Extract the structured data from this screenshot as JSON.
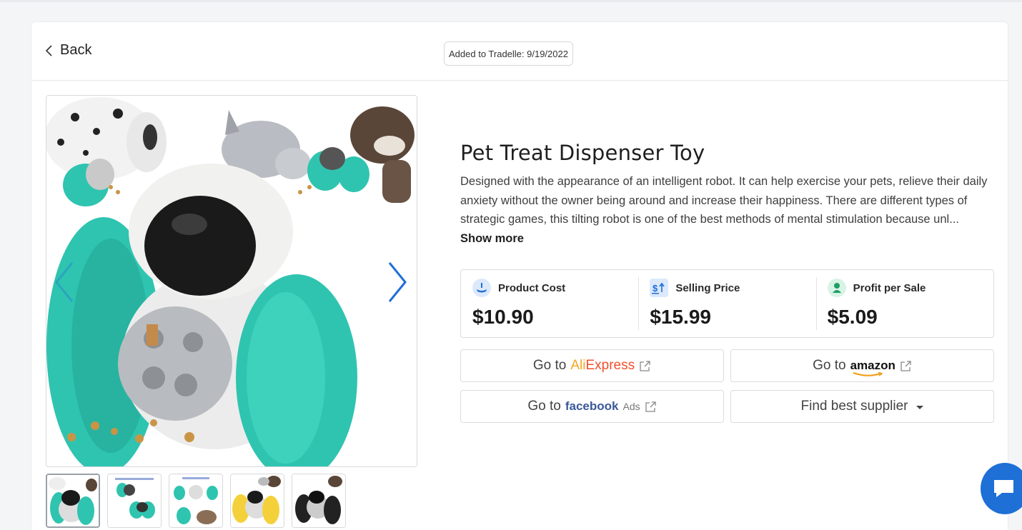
{
  "header": {
    "back_label": "Back",
    "added_badge": "Added to Tradelle: 9/19/2022"
  },
  "product": {
    "title": "Pet Treat Dispenser Toy",
    "description": "Designed with the appearance of an intelligent robot. It can help exercise your pets, relieve their daily anxiety without the owner being around and increase their happiness. There are different types of strategic games, this tilting robot is one of the best methods of mental stimulation because unl...",
    "show_more": "Show more"
  },
  "gallery": {
    "thumbnail_count": 5,
    "active_index": 0
  },
  "stats": {
    "product_cost": {
      "label": "Product Cost",
      "value": "$10.90",
      "icon": "product-cost-icon"
    },
    "selling_price": {
      "label": "Selling Price",
      "value": "$15.99",
      "icon": "selling-price-icon"
    },
    "profit": {
      "label": "Profit per Sale",
      "value": "$5.09",
      "icon": "profit-icon"
    }
  },
  "actions": {
    "go_to": "Go to",
    "aliexpress_a": "Ali",
    "aliexpress_b": "Express",
    "amazon": "amazon",
    "facebook": "facebook",
    "facebook_ads": "Ads",
    "find_supplier": "Find best supplier"
  },
  "colors": {
    "accent_blue": "#1e6fd6",
    "toy_teal": "#2fc4b0",
    "aliexpress_red": "#f0502d",
    "facebook_blue": "#3b5998"
  }
}
